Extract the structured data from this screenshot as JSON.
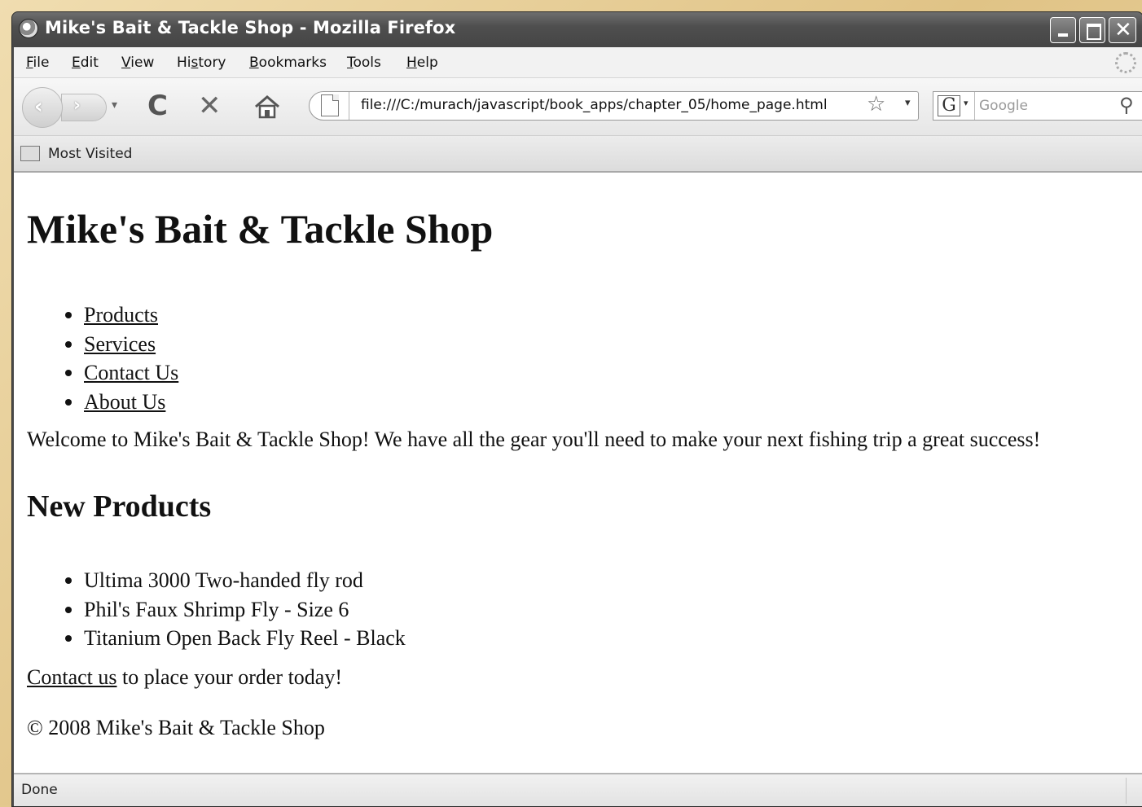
{
  "window": {
    "title": "Mike's Bait & Tackle Shop - Mozilla Firefox",
    "controls": {
      "minimize": "minimize",
      "maximize": "maximize",
      "close": "✕"
    }
  },
  "menu": [
    "File",
    "Edit",
    "View",
    "History",
    "Bookmarks",
    "Tools",
    "Help"
  ],
  "menu_access_keys": [
    "F",
    "E",
    "V",
    "s",
    "B",
    "T",
    "H"
  ],
  "toolbar": {
    "url": "file:///C:/murach/javascript/book_apps/chapter_05/home_page.html",
    "search_placeholder": "Google",
    "search_engine": "G"
  },
  "bookmarks": {
    "most_visited": "Most Visited"
  },
  "page": {
    "heading": "Mike's Bait & Tackle Shop",
    "nav": [
      "Products",
      "Services",
      "Contact Us",
      "About Us"
    ],
    "welcome": "Welcome to Mike's Bait & Tackle Shop! We have all the gear you'll need to make your next fishing trip a great success!",
    "new_products_heading": "New Products",
    "products": [
      "Ultima 3000 Two-handed fly rod",
      "Phil's Faux Shrimp Fly - Size 6",
      "Titanium Open Back Fly Reel - Black"
    ],
    "cta_link": "Contact us",
    "cta_rest": " to place your order today!",
    "footer": "© 2008 Mike's Bait & Tackle Shop"
  },
  "status": {
    "text": "Done"
  },
  "colors": {
    "titlebar": "#4f4f4f",
    "content_bg": "#ffffff",
    "slide_bg": "#e3c98e"
  }
}
